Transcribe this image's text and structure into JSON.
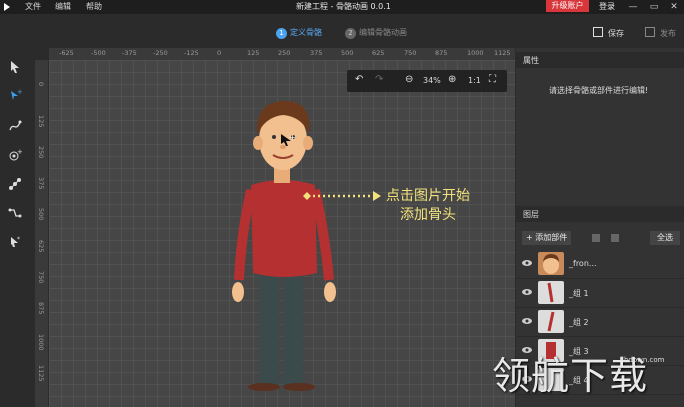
{
  "menubar": {
    "items": [
      "文件",
      "编辑",
      "帮助"
    ],
    "title": "新建工程 - 骨骼动画 0.0.1",
    "upgrade": "升级账户",
    "login": "登录",
    "window_buttons": [
      "minimize-icon",
      "maximize-icon",
      "close-icon"
    ]
  },
  "steps": {
    "step1": {
      "num": "1",
      "label": "定义骨骼"
    },
    "step2": {
      "num": "2",
      "label": "编辑骨骼动画"
    },
    "save": "保存",
    "publish": "发布"
  },
  "toolbar": {
    "tools": [
      "select-arrow-icon",
      "add-bone-icon",
      "curve-bone-icon",
      "add-point-icon",
      "bone-chain-icon",
      "path-icon",
      "select-bone-icon"
    ]
  },
  "ruler": {
    "h_ticks": [
      "-625",
      "-500",
      "-375",
      "-250",
      "-125",
      "0",
      "125",
      "250",
      "375",
      "500",
      "625",
      "750",
      "875",
      "1000",
      "1125",
      "125"
    ],
    "v_ticks": [
      "0",
      "125",
      "250",
      "375",
      "500",
      "625",
      "750",
      "875",
      "1000",
      "1125"
    ]
  },
  "canvas": {
    "zoom": "34%",
    "ratio": "1:1",
    "hint_line1": "点击图片开始",
    "hint_line2": "添加骨头"
  },
  "properties": {
    "title": "属性",
    "hint": "请选择骨骼或部件进行编辑!"
  },
  "layers": {
    "title": "图层",
    "add_button": "添加部件",
    "select_all": "全选",
    "items": [
      "_fron...",
      "_组 1",
      "_组 2",
      "_组 3",
      "_组 4"
    ]
  },
  "watermark": {
    "text": "领航下载",
    "url": "lhdown.com"
  }
}
